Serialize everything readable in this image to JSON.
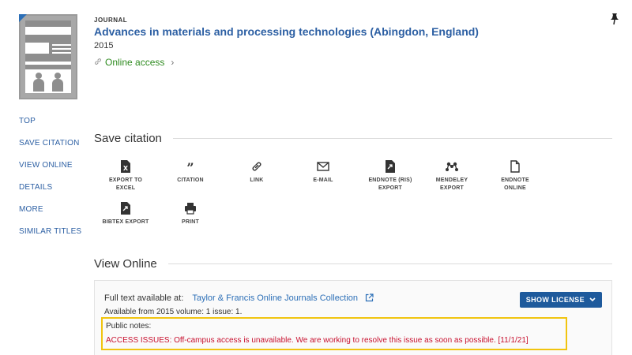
{
  "record": {
    "type_label": "JOURNAL",
    "title": "Advances in materials and processing technologies (Abingdon, England)",
    "year": "2015",
    "online_access": "Online access"
  },
  "sidebar": {
    "items": [
      {
        "label": "TOP"
      },
      {
        "label": "SAVE CITATION"
      },
      {
        "label": "VIEW ONLINE"
      },
      {
        "label": "DETAILS"
      },
      {
        "label": "MORE"
      },
      {
        "label": "SIMILAR TITLES"
      }
    ]
  },
  "save_citation": {
    "heading": "Save citation",
    "tools": [
      {
        "label_1": "EXPORT TO",
        "label_2": "EXCEL",
        "icon": "excel-icon"
      },
      {
        "label_1": "CITATION",
        "label_2": "",
        "icon": "quote-icon"
      },
      {
        "label_1": "LINK",
        "label_2": "",
        "icon": "link-icon"
      },
      {
        "label_1": "E-MAIL",
        "label_2": "",
        "icon": "email-icon"
      },
      {
        "label_1": "ENDNOTE (RIS)",
        "label_2": "EXPORT",
        "icon": "file-export-icon"
      },
      {
        "label_1": "MENDELEY",
        "label_2": "EXPORT",
        "icon": "mendeley-icon"
      },
      {
        "label_1": "ENDNOTE",
        "label_2": "ONLINE",
        "icon": "document-icon"
      },
      {
        "label_1": "BIBTEX EXPORT",
        "label_2": "",
        "icon": "file-export-icon"
      },
      {
        "label_1": "PRINT",
        "label_2": "",
        "icon": "print-icon"
      }
    ]
  },
  "view_online": {
    "heading": "View Online",
    "full_text_label": "Full text available at:",
    "provider": "Taylor & Francis Online Journals Collection",
    "availability": "Available from 2015 volume: 1 issue: 1.",
    "show_license": "SHOW LICENSE",
    "public_notes_label": "Public notes:",
    "public_notes_text": "ACCESS ISSUES: Off-campus access is unavailable. We are working to resolve this issue as soon as possible. [11/1/21]"
  },
  "colors": {
    "link_blue": "#2c5fa3",
    "online_green": "#2e8b1f",
    "button_blue": "#1e5a9c",
    "alert_red": "#c8102e",
    "highlight_yellow": "#f1c40f"
  }
}
